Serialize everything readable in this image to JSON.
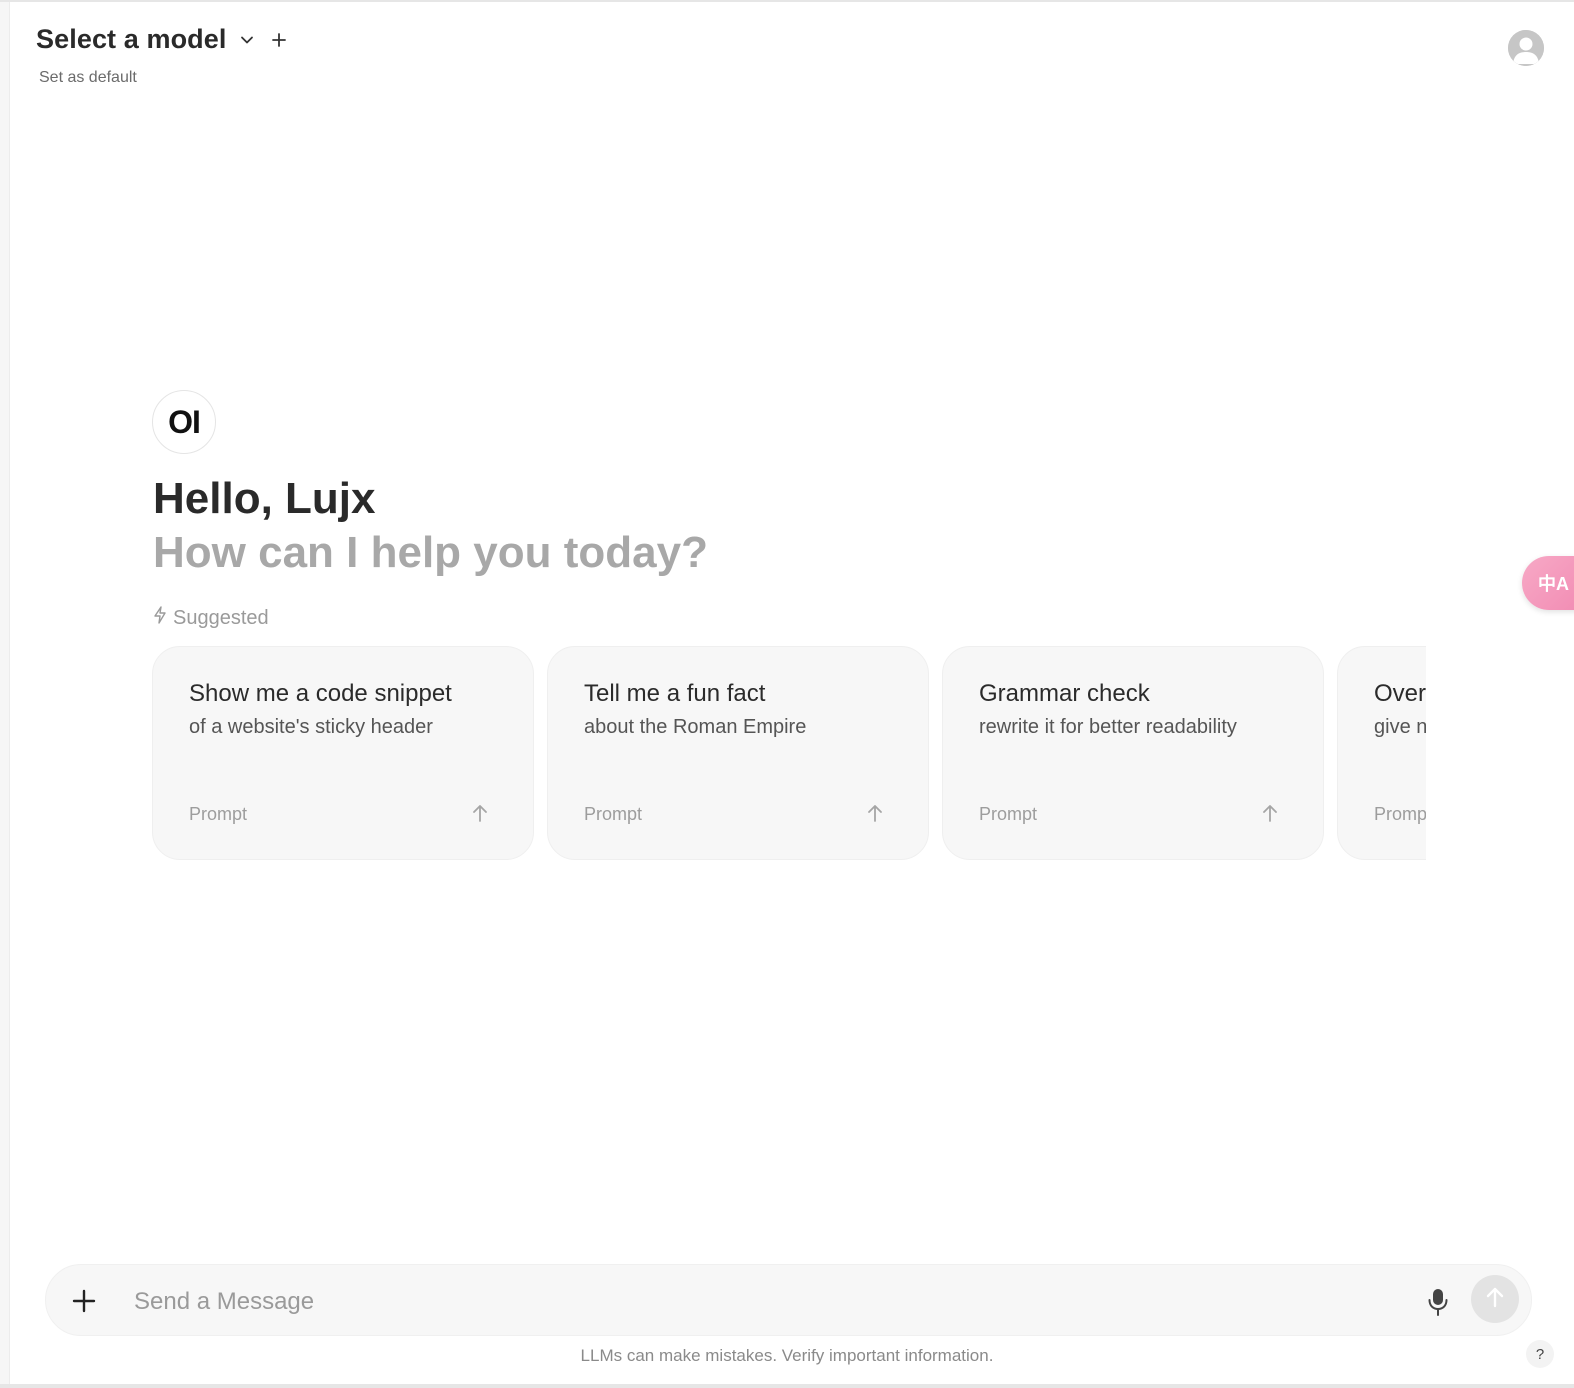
{
  "header": {
    "model_title": "Select a model",
    "set_default": "Set as default"
  },
  "hero": {
    "logo_text": "OI",
    "greeting": "Hello, Lujx",
    "subgreeting": "How can I help you today?",
    "suggested_label": "Suggested"
  },
  "suggestions": [
    {
      "title": "Show me a code snippet",
      "subtitle": "of a website's sticky header",
      "tag": "Prompt"
    },
    {
      "title": "Tell me a fun fact",
      "subtitle": "about the Roman Empire",
      "tag": "Prompt"
    },
    {
      "title": "Grammar check",
      "subtitle": "rewrite it for better readability",
      "tag": "Prompt"
    },
    {
      "title": "Over",
      "subtitle": "give n",
      "tag": "Prompt"
    }
  ],
  "composer": {
    "placeholder": "Send a Message",
    "value": ""
  },
  "footer": {
    "disclaimer": "LLMs can make mistakes. Verify important information.",
    "help_label": "?"
  },
  "translate_fab": {
    "label": "中A"
  },
  "icons": {
    "model_dropdown": "chevron-down-icon",
    "add_model": "plus-icon",
    "avatar": "user-avatar-icon",
    "suggested": "lightning-icon",
    "card_send": "arrow-up-icon",
    "attach": "plus-icon",
    "mic": "microphone-icon",
    "send": "arrow-up-icon",
    "translate": "translate-icon"
  },
  "colors": {
    "card_bg": "#f7f7f7",
    "send_button_bg": "#e3e3e3",
    "translate_fab": "#f28db4"
  }
}
